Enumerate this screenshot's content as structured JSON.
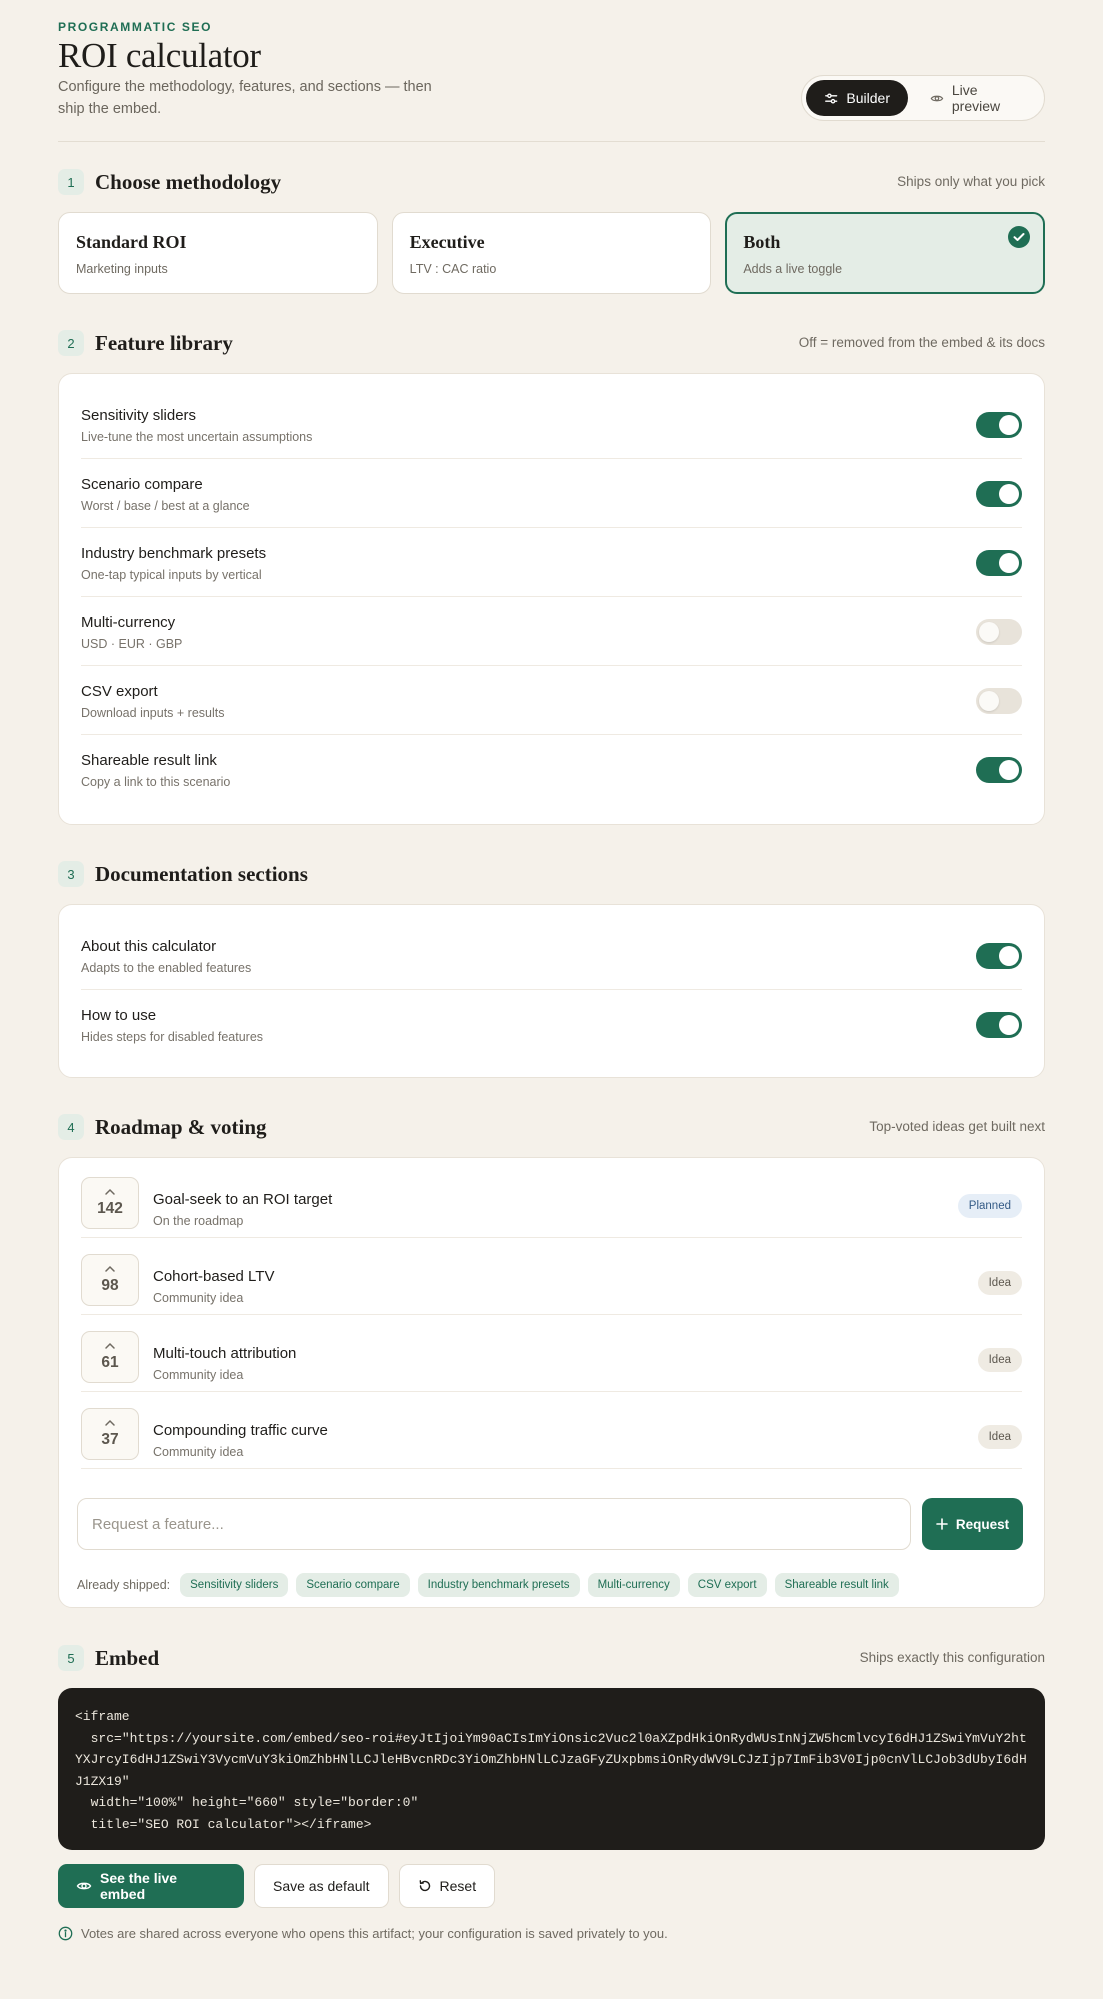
{
  "header": {
    "eyebrow": "PROGRAMMATIC SEO",
    "title": "ROI calculator",
    "subtitle": "Configure the methodology, features, and sections — then ship the embed.",
    "view_switch": {
      "builder": "Builder",
      "live_preview": "Live preview",
      "active": "Builder"
    }
  },
  "methodology": {
    "number": "1",
    "title": "Choose methodology",
    "note": "Ships only what you pick",
    "options": [
      {
        "title": "Standard ROI",
        "subtitle": "Marketing inputs",
        "selected": false
      },
      {
        "title": "Executive",
        "subtitle": "LTV : CAC ratio",
        "selected": false
      },
      {
        "title": "Both",
        "subtitle": "Adds a live toggle",
        "selected": true
      }
    ]
  },
  "features": {
    "number": "2",
    "title": "Feature library",
    "note": "Off = removed from the embed & its docs",
    "items": [
      {
        "title": "Sensitivity sliders",
        "subtitle": "Live-tune the most uncertain assumptions",
        "enabled": true
      },
      {
        "title": "Scenario compare",
        "subtitle": "Worst / base / best at a glance",
        "enabled": true
      },
      {
        "title": "Industry benchmark presets",
        "subtitle": "One-tap typical inputs by vertical",
        "enabled": true
      },
      {
        "title": "Multi-currency",
        "subtitle": "USD · EUR · GBP",
        "enabled": false
      },
      {
        "title": "CSV export",
        "subtitle": "Download inputs + results",
        "enabled": false
      },
      {
        "title": "Shareable result link",
        "subtitle": "Copy a link to this scenario",
        "enabled": true
      }
    ]
  },
  "docs": {
    "number": "3",
    "title": "Documentation sections",
    "items": [
      {
        "title": "About this calculator",
        "subtitle": "Adapts to the enabled features",
        "enabled": true
      },
      {
        "title": "How to use",
        "subtitle": "Hides steps for disabled features",
        "enabled": true
      }
    ]
  },
  "roadmap": {
    "number": "4",
    "title": "Roadmap & voting",
    "note": "Top-voted ideas get built next",
    "items": [
      {
        "votes": "142",
        "title": "Goal-seek to an ROI target",
        "subtitle": "On the roadmap",
        "status": "Planned"
      },
      {
        "votes": "98",
        "title": "Cohort-based LTV",
        "subtitle": "Community idea",
        "status": "Idea"
      },
      {
        "votes": "61",
        "title": "Multi-touch attribution",
        "subtitle": "Community idea",
        "status": "Idea"
      },
      {
        "votes": "37",
        "title": "Compounding traffic curve",
        "subtitle": "Community idea",
        "status": "Idea"
      }
    ],
    "request_placeholder": "Request a feature...",
    "request_button": "Request",
    "shipped_label": "Already shipped:",
    "shipped": [
      "Sensitivity sliders",
      "Scenario compare",
      "Industry benchmark presets",
      "Multi-currency",
      "CSV export",
      "Shareable result link"
    ]
  },
  "embed": {
    "number": "5",
    "title": "Embed",
    "note": "Ships exactly this configuration",
    "code": "<iframe\n  src=\"https://yoursite.com/embed/seo-roi#eyJtIjoiYm90aCIsImYiOnsic2Vuc2l0aXZpdHkiOnRydWUsInNjZW5hcmlvcyI6dHJ1ZSwiYmVuY2htYXJrcyI6dHJ1ZSwiY3VycmVuY3kiOmZhbHNlLCJleHBvcnRDc3YiOmZhbHNlLCJzaGFyZUxpbmsiOnRydWV9LCJzIjp7ImFib3V0Ijp0cnVlLCJob3dUbyI6dHJ1ZX19\"\n  width=\"100%\" height=\"660\" style=\"border:0\"\n  title=\"SEO ROI calculator\"></iframe>",
    "buttons": {
      "live": "See the live embed",
      "save": "Save as default",
      "reset": "Reset"
    },
    "footnote": "Votes are shared across everyone who opens this artifact; your configuration is saved privately to you."
  },
  "colors": {
    "accent": "#1f6e54",
    "background": "#f5f1ea",
    "dark": "#1f1d1a",
    "planned_bg": "#e6eef7"
  }
}
